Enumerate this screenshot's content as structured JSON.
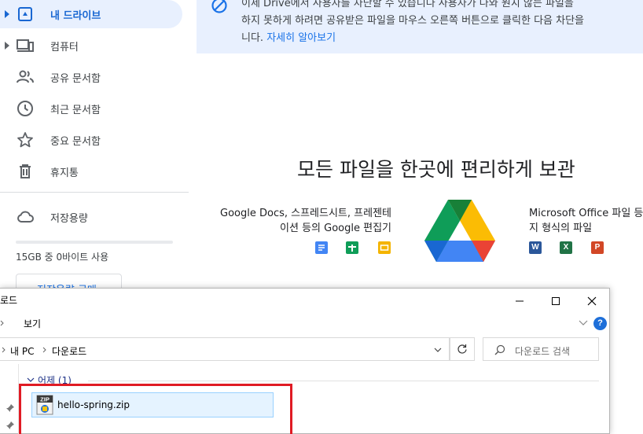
{
  "sidebar": {
    "items": [
      {
        "label": "내 드라이브",
        "icon": "drive-icon"
      },
      {
        "label": "컴퓨터",
        "icon": "computer-icon"
      },
      {
        "label": "공유 문서함",
        "icon": "people-icon"
      },
      {
        "label": "최근 문서함",
        "icon": "clock-icon"
      },
      {
        "label": "중요 문서함",
        "icon": "star-icon"
      },
      {
        "label": "휴지통",
        "icon": "trash-icon"
      },
      {
        "label": "저장용량",
        "icon": "cloud-icon"
      }
    ],
    "storage_text": "15GB 중 0바이트 사용",
    "buy_storage_label": "저장용량 구매"
  },
  "banner": {
    "line1": "이제 Drive에서 사용자를 차단할 수 있습니다 사용자가 나와 원치 않는 파일을",
    "line2": "하지 못하게 하려면 공유받은 파일을 마우스 오른쪽 버튼으로 클릭한 다음 차단을",
    "line3_prefix": "니다.",
    "learn_more": "자세히 알아보기"
  },
  "main": {
    "title": "모든 파일을 한곳에 편리하게 보관",
    "left_line1": "Google Docs, 스프레드시트, 프레젠테",
    "left_line2": "이션 등의 Google 편집기",
    "right_line1": "Microsoft Office 파일 등",
    "right_line2": "지 형식의 파일",
    "office_letters": [
      "W",
      "X",
      "P"
    ]
  },
  "explorer": {
    "title": "로드",
    "ribbon_tab": "보기",
    "path": [
      "내 PC",
      "다운로드"
    ],
    "search_placeholder": "다운로드 검색",
    "group_header": "어제 (1)",
    "file": {
      "name": "hello-spring.zip",
      "icon": "zip-file-icon"
    },
    "colors": {
      "highlight": "#e01b24",
      "selection": "#e5f3ff"
    }
  },
  "colors": {
    "accent": "#1a73e8",
    "active_bg": "#e8f0fe"
  }
}
